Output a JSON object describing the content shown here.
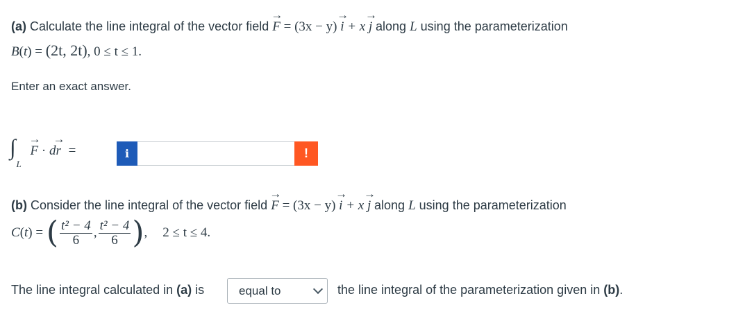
{
  "part_a": {
    "label": "(a)",
    "prefix": "Calculate the line integral of the vector field",
    "along": "along",
    "suffix": "using the parameterization",
    "param_name": "B",
    "param_value": "(2t, 2t)",
    "range": "0 ≤ t ≤ 1.",
    "instruction": "Enter an exact answer."
  },
  "vector_field": {
    "F": "F",
    "eq": "=",
    "first": "(3x − y)",
    "i": "i",
    "plus": "+ x",
    "j": "j",
    "L": "L"
  },
  "integral": {
    "symbol": "∫",
    "sub": "L",
    "F": "F",
    "dot": "·",
    "d": "d",
    "r": "r",
    "eq": "="
  },
  "answer": {
    "info_icon": "i",
    "value": "",
    "warning_icon": "!"
  },
  "part_b": {
    "label": "(b)",
    "prefix": "Consider the line integral of the vector field",
    "param_name": "C",
    "num1": "t² − 4",
    "den1": "6",
    "num2": "t² − 4",
    "den2": "6",
    "range": "2 ≤ t ≤ 4."
  },
  "comparison": {
    "prefix": "The line integral calculated in",
    "ref_a": "(a)",
    "is": "is",
    "selected": "equal to",
    "suffix_text": "the line integral of the parameterization given in",
    "ref_b": "(b)",
    "period": "."
  }
}
